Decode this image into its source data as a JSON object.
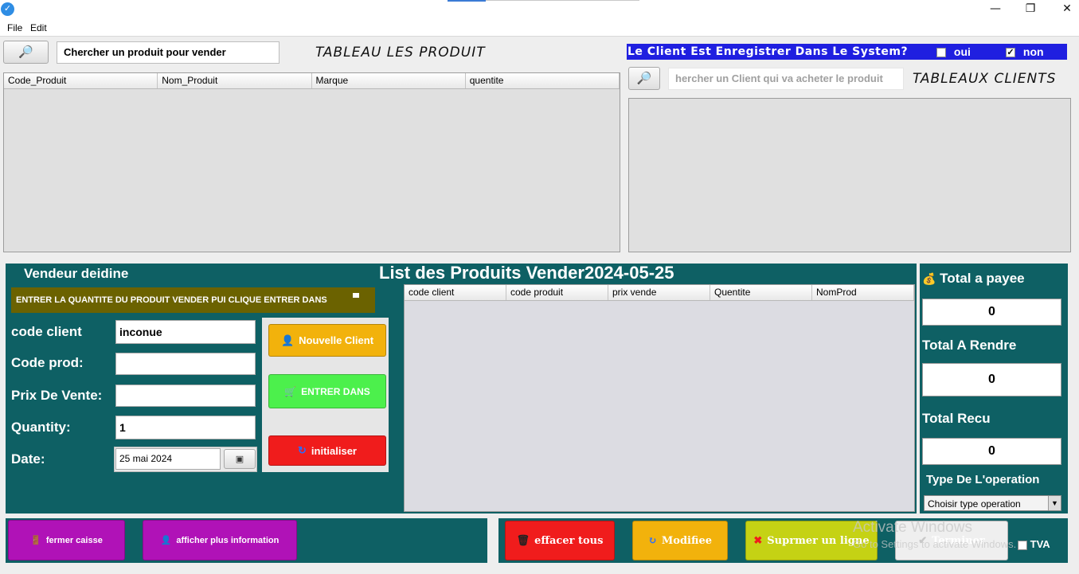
{
  "window": {
    "minimize": "—",
    "restore": "❐",
    "close": "✕"
  },
  "menu": {
    "items": [
      "File",
      "Edit"
    ]
  },
  "products": {
    "search_placeholder": "Chercher un produit pour vender",
    "title": "TABLEAU LES PRODUIT",
    "columns": [
      "Code_Produit",
      "Nom_Produit",
      "Marque",
      "quentite"
    ]
  },
  "clients": {
    "question": "Le Client Est Enregistrer Dans Le System?",
    "oui_label": "oui",
    "non_label": "non",
    "oui_checked": false,
    "non_checked": true,
    "search_placeholder": "hercher un Client qui va acheter le produit",
    "title": "TABLEAUX CLIENTS"
  },
  "sale": {
    "vendor": "Vendeur deidine",
    "list_title": "List des Produits Vender2024-05-25",
    "instruction": "ENTRER LA QUANTITE DU PRODUIT VENDER PUI CLIQUE ENTRER DANS",
    "labels": {
      "code_client": "code client",
      "code_prod": "Code prod:",
      "prix": "Prix De Vente:",
      "quantity": "Quantity:",
      "date": "Date:"
    },
    "values": {
      "code_client": "inconue",
      "code_prod": "",
      "prix": "",
      "quantity": "1",
      "date": "25 mai 2024"
    },
    "buttons": {
      "nouvelle_client": "Nouvelle Client",
      "entrer_dans": "ENTRER DANS",
      "initialiser": "initialiser"
    },
    "columns": [
      "code client",
      "code produit",
      "prix vende",
      "Quentite",
      "NomProd"
    ]
  },
  "totals": {
    "total_a_payee_label": "Total a payee",
    "total_a_payee": "0",
    "total_a_rendre_label": "Total A Rendre",
    "total_a_rendre": "0",
    "total_recu_label": "Total Recu",
    "total_recu": "0",
    "type_label": "Type De L'operation",
    "type_selected": "Choisir type operation"
  },
  "bottom": {
    "fermer_caisse": "fermer caisse",
    "afficher_info": "afficher plus information",
    "effacer_tous": "effacer tous",
    "modifiee": "Modifiee",
    "supprimer": "Suprmer un ligne",
    "terminer": "Terminer",
    "tva": "TVA"
  },
  "watermark": {
    "line1": "Activate Windows",
    "line2": "Go to Settings to activate Windows."
  },
  "colors": {
    "teal": "#0e6064",
    "header_blue": "#1f1fe0",
    "olive": "#6b6200",
    "orange": "#f2b20c",
    "green": "#4cf04c",
    "red": "#f01c1c",
    "magenta": "#b012b7"
  }
}
